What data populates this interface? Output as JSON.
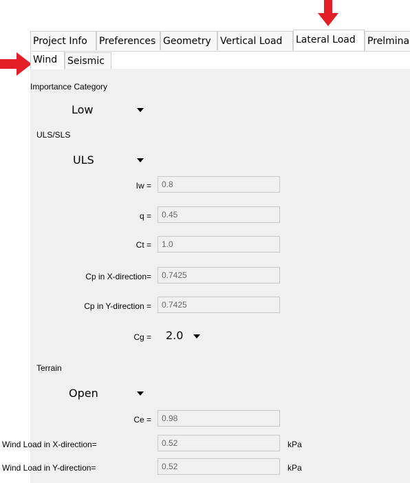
{
  "tabs": [
    "Project Info",
    "Preferences",
    "Geometry",
    "Vertical Load",
    "Lateral Load",
    "Prelmina"
  ],
  "subtabs": [
    "Wind",
    "Seismic"
  ],
  "importance": {
    "label": "Importance Category",
    "value": "Low"
  },
  "uls": {
    "label": "ULS/SLS",
    "value": "ULS"
  },
  "iw": {
    "label": "Iw =",
    "value": "0.8"
  },
  "q": {
    "label": "q =",
    "value": "0.45"
  },
  "ct": {
    "label": "Ct =",
    "value": "1.0"
  },
  "cpx": {
    "label": "Cp in X-direction=",
    "value": "0.7425"
  },
  "cpy": {
    "label": "Cp in Y-direction =",
    "value": "0.7425"
  },
  "cg": {
    "label": "Cg =",
    "value": "2.0"
  },
  "terrain": {
    "label": "Terrain",
    "value": "Open"
  },
  "ce": {
    "label": "Ce =",
    "value": "0.98"
  },
  "wlx": {
    "label": "Wind Load in X-direction=",
    "value": "0.52",
    "unit": "kPa"
  },
  "wly": {
    "label": "Wind Load in Y-direction=",
    "value": "0.52",
    "unit": "kPa"
  },
  "colors": {
    "arrow": "#e21f26",
    "panel": "#f0f0f0"
  }
}
